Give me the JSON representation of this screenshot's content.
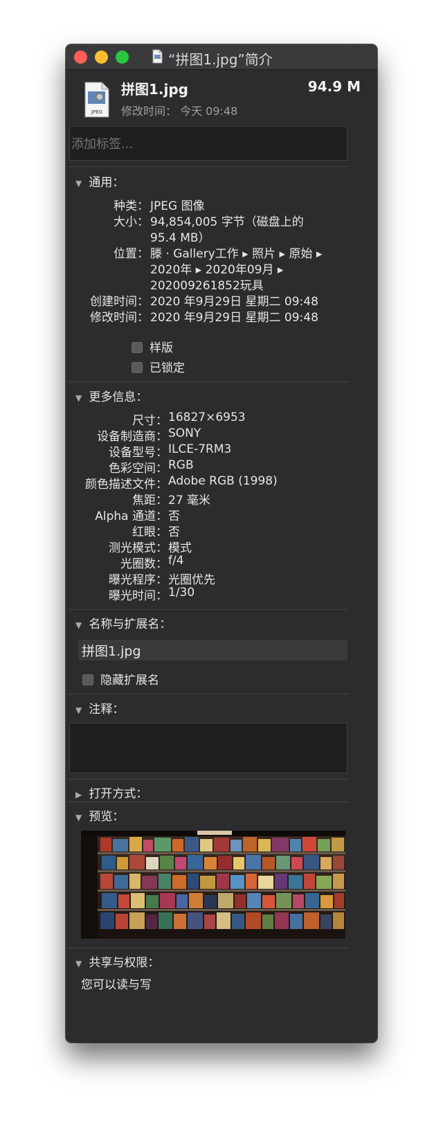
{
  "window": {
    "title": "“拼图1.jpg”简介"
  },
  "header": {
    "file_name": "拼图1.jpg",
    "file_size": "94.9 M",
    "modified": "修改时间： 今天 09:48",
    "icon_label": "JPEG"
  },
  "tags": {
    "placeholder": "添加标签..."
  },
  "general": {
    "title": "通用：",
    "rows": [
      {
        "label": "种类：",
        "value": "JPEG 图像"
      },
      {
        "label": "大小：",
        "value": "94,854,005 字节（磁盘上的"
      },
      {
        "label": "",
        "value": "95.4 MB）"
      },
      {
        "label": "位置：",
        "value": "滕 · Gallery工作 ▸ 照片 ▸ 原始 ▸"
      },
      {
        "label": "",
        "value": "2020年 ▸ 2020年09月 ▸"
      },
      {
        "label": "",
        "value": "202009261852玩具"
      },
      {
        "label": "创建时间：",
        "value": "2020 年9月29日 星期二 09:48"
      },
      {
        "label": "修改时间：",
        "value": "2020 年9月29日 星期二 09:48"
      }
    ],
    "stationery": "样版",
    "locked": "已锁定"
  },
  "more_info": {
    "title": "更多信息：",
    "rows": [
      {
        "label": "尺寸：",
        "value": "16827×6953"
      },
      {
        "label": "设备制造商：",
        "value": "SONY"
      },
      {
        "label": "设备型号：",
        "value": "ILCE-7RM3"
      },
      {
        "label": "色彩空间：",
        "value": "RGB"
      },
      {
        "label": "颜色描述文件：",
        "value": "Adobe RGB (1998)"
      },
      {
        "label": "焦距：",
        "value": "27 毫米"
      },
      {
        "label": "Alpha 通道：",
        "value": "否"
      },
      {
        "label": "红眼：",
        "value": "否"
      },
      {
        "label": "测光模式：",
        "value": "模式"
      },
      {
        "label": "光圈数：",
        "value": "f/4"
      },
      {
        "label": "曝光程序：",
        "value": "光圈优先"
      },
      {
        "label": "曝光时间：",
        "value": "1/30"
      }
    ]
  },
  "name_ext": {
    "title": "名称与扩展名：",
    "value": "拼图1.jpg",
    "hide_ext": "隐藏扩展名"
  },
  "comments": {
    "title": "注释："
  },
  "open_with": {
    "title": "打开方式："
  },
  "preview": {
    "title": "预览："
  },
  "sharing": {
    "title": "共享与权限：",
    "text": "您可以读与写"
  }
}
